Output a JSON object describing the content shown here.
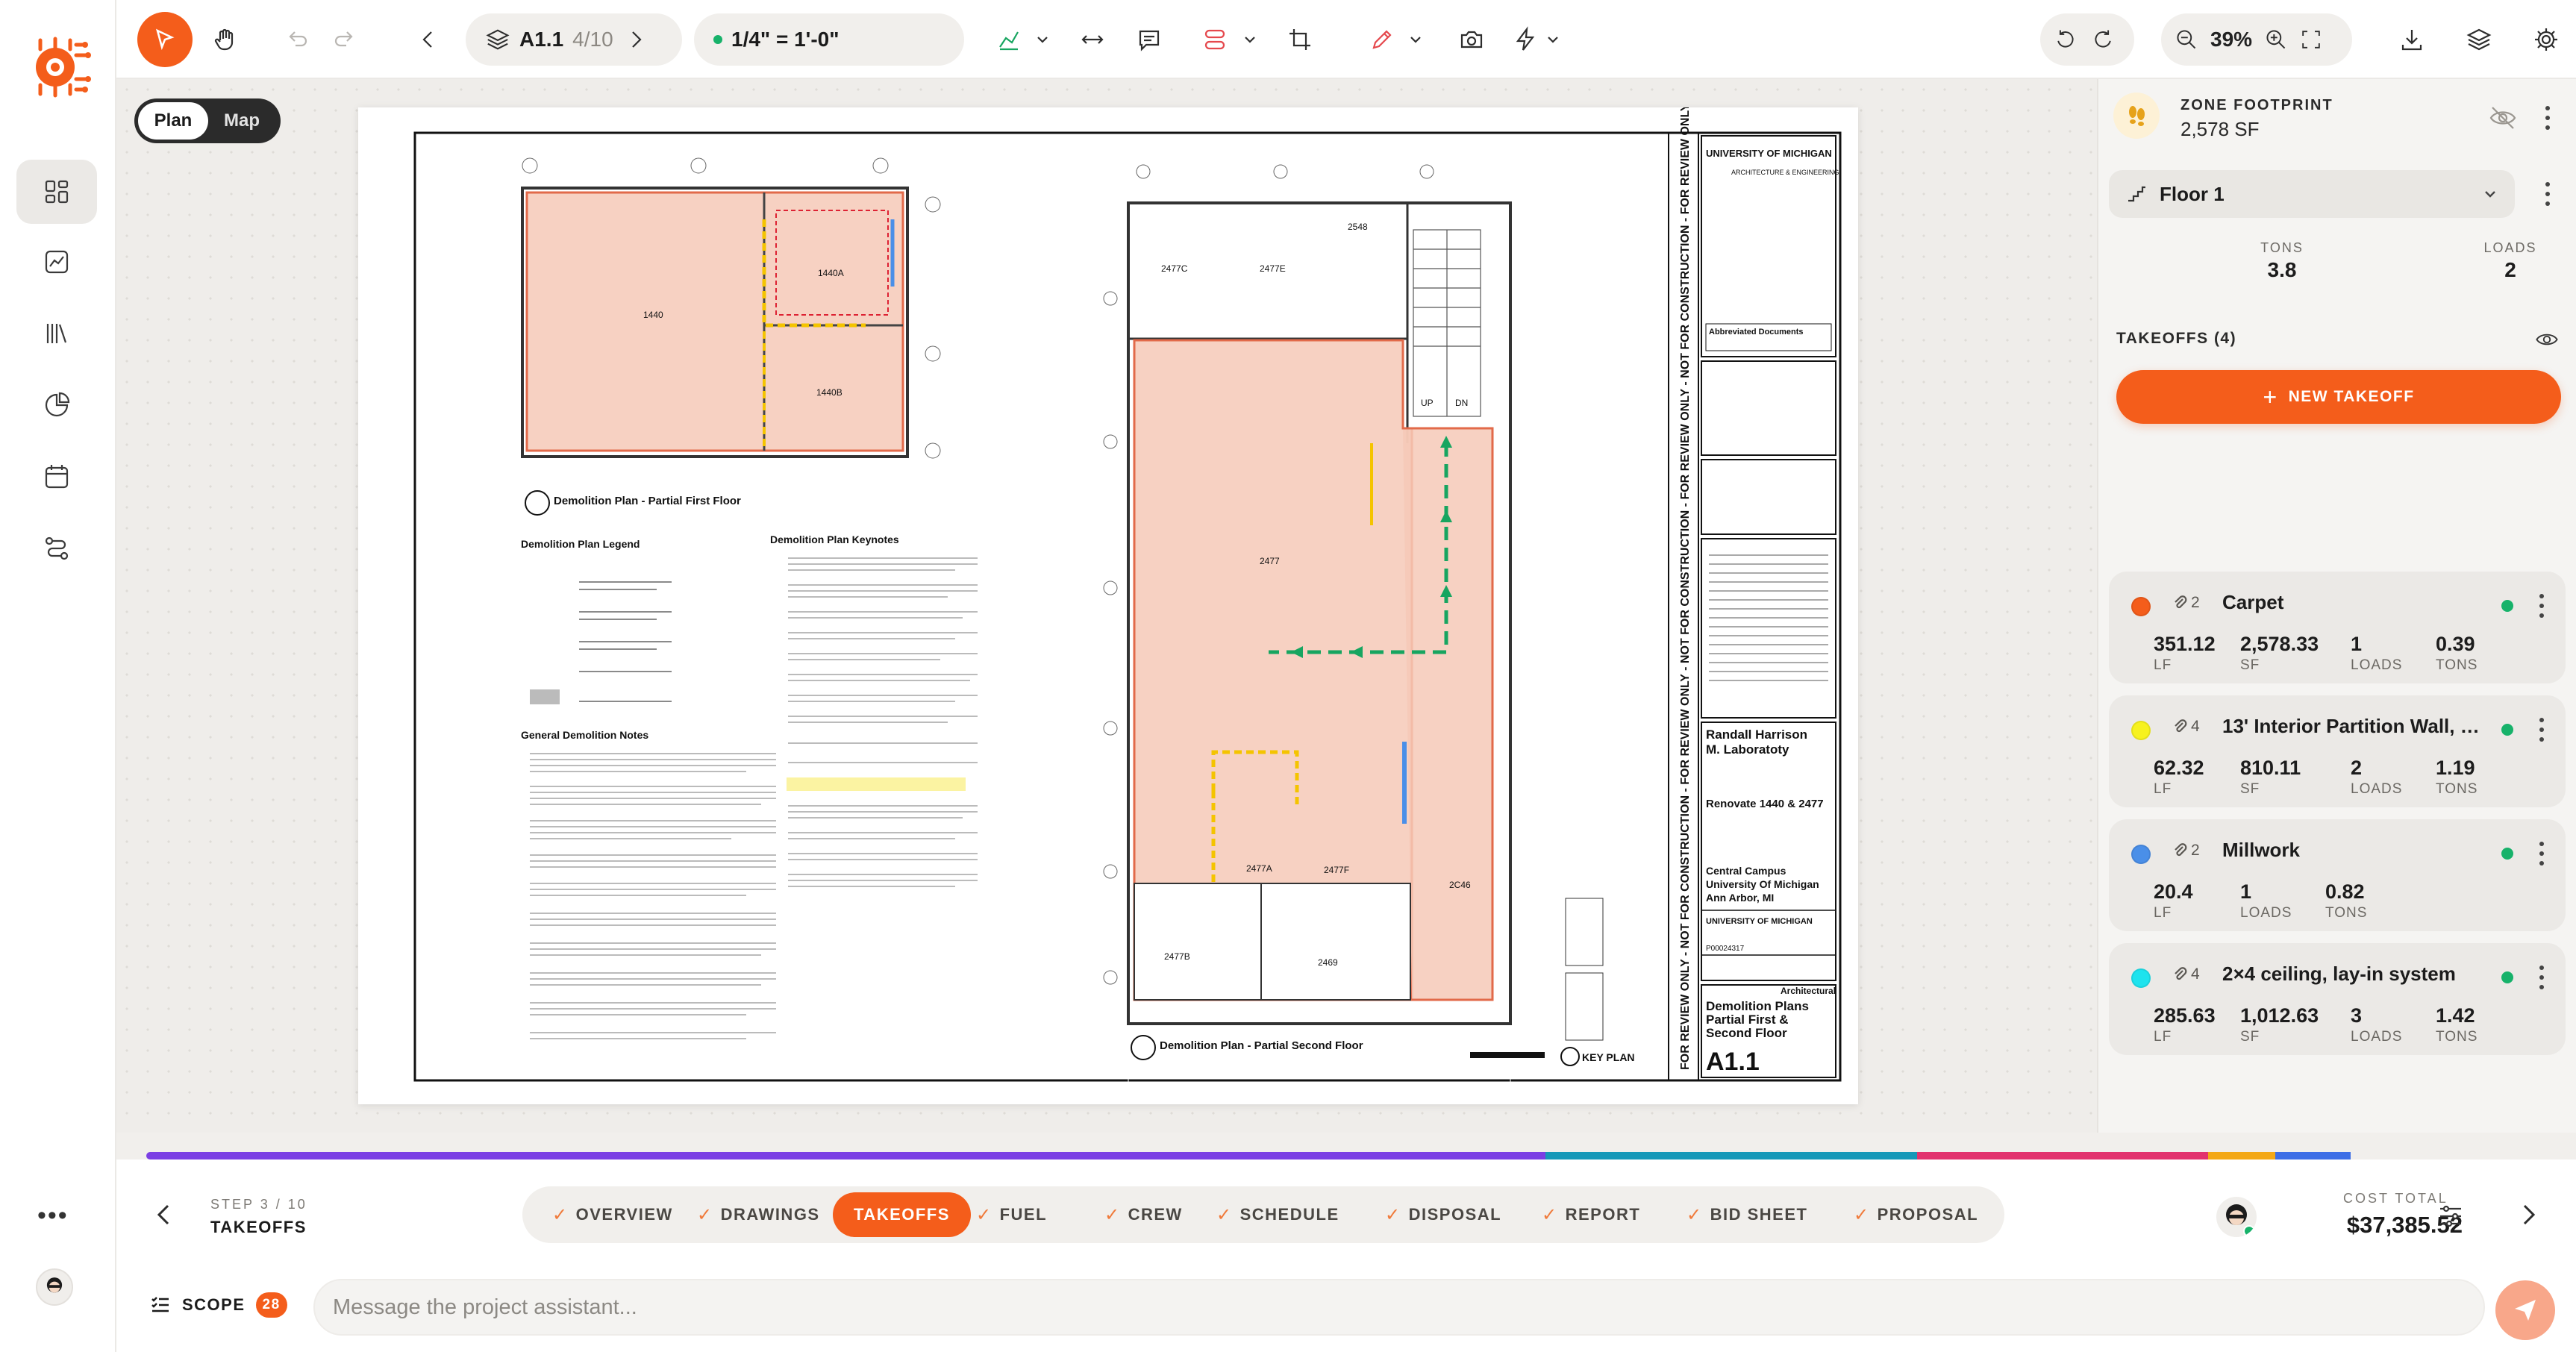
{
  "toolbar": {
    "sheet_code": "A1.1",
    "sheet_position": "4/10",
    "scale": "1/4\" = 1'-0\"",
    "zoom": "39%"
  },
  "view_toggle": {
    "plan": "Plan",
    "map": "Map"
  },
  "sheet": {
    "plan_first_title": "Demolition Plan - Partial First Floor",
    "plan_second_title": "Demolition Plan - Partial  Second Floor",
    "legend_title": "Demolition Plan Legend",
    "keynotes_title": "Demolition Plan Keynotes",
    "general_notes_title": "General Demolition Notes",
    "key_plan": "KEY PLAN",
    "vertical_banner": "FOR REVIEW ONLY - NOT FOR CONSTRUCTION - FOR REVIEW ONLY - NOT FOR CONSTRUCTION - FOR REVIEW ONLY - NOT FOR CONSTRUCTION - FOR REVIEW ONLY - NOT FOR CONSTRUCTION",
    "university": "UNIVERSITY OF MICHIGAN",
    "dept": "ARCHITECTURE & ENGINEERING",
    "abbrev": "Abbreviated Documents",
    "project_name_1": "Randall Harrison",
    "project_name_2": "M. Laboratoty",
    "renovate": "Renovate 1440 & 2477",
    "campus_1": "Central Campus",
    "campus_2": "University Of Michigan",
    "campus_3": "Ann Arbor, MI",
    "discipline": "Architectural",
    "sheet_title_1": "Demolition Plans",
    "sheet_title_2": "Partial First &",
    "sheet_title_3": "Second Floor",
    "sheet_number": "A1.1",
    "project_no": "P00024317",
    "room_1440": "1440",
    "room_1440a": "1440A",
    "room_1440b": "1440B",
    "room_2477": "2477",
    "room_2477c": "2477C",
    "room_2477a": "2477A",
    "room_2477b": "2477B",
    "room_2477f": "2477F",
    "room_2477e": "2477E",
    "room_2548": "2548",
    "room_2469": "2469",
    "room_2c46": "2C46",
    "up": "UP",
    "dn": "DN"
  },
  "panel": {
    "zone_label": "ZONE FOOTPRINT",
    "zone_area": "2,578 SF",
    "floor": "Floor 1",
    "tons_label": "TONS",
    "tons_value": "3.8",
    "loads_label": "LOADS",
    "loads_value": "2",
    "takeoffs_header": "TAKEOFFS (4)",
    "new_takeoff": "NEW TAKEOFF",
    "takeoffs": [
      {
        "name": "Carpet",
        "color": "#f45d1b",
        "count": "2",
        "metrics": [
          {
            "v": "351.12",
            "u": "LF"
          },
          {
            "v": "2,578.33",
            "u": "SF"
          },
          {
            "v": "1",
            "u": "LOADS"
          },
          {
            "v": "0.39",
            "u": "TONS"
          }
        ]
      },
      {
        "name": "13' Interior Partition Wall, M...",
        "color": "#f7f21e",
        "count": "4",
        "metrics": [
          {
            "v": "62.32",
            "u": "LF"
          },
          {
            "v": "810.11",
            "u": "SF"
          },
          {
            "v": "2",
            "u": "LOADS"
          },
          {
            "v": "1.19",
            "u": "TONS"
          }
        ]
      },
      {
        "name": "Millwork",
        "color": "#4a8fe8",
        "count": "2",
        "metrics": [
          {
            "v": "20.4",
            "u": "LF"
          },
          {
            "v": "1",
            "u": "LOADS"
          },
          {
            "v": "0.82",
            "u": "TONS"
          }
        ]
      },
      {
        "name": "2×4 ceiling, lay-in system",
        "color": "#1ee3ee",
        "count": "4",
        "metrics": [
          {
            "v": "285.63",
            "u": "LF"
          },
          {
            "v": "1,012.63",
            "u": "SF"
          },
          {
            "v": "3",
            "u": "LOADS"
          },
          {
            "v": "1.42",
            "u": "TONS"
          }
        ]
      }
    ]
  },
  "progress_segments": [
    {
      "color": "#7b3fe4",
      "fraction": 0.5827
    },
    {
      "color": "#1698b8",
      "fraction": 0.1546
    },
    {
      "color": "#e2336e",
      "fraction": 0.1214
    },
    {
      "color": "#f3a816",
      "fraction": 0.0279
    },
    {
      "color": "#3d6ee6",
      "fraction": 0.0314
    }
  ],
  "stepper": {
    "step_label": "STEP 3 / 10",
    "step_name": "TAKEOFFS",
    "steps": [
      "OVERVIEW",
      "DRAWINGS",
      "TAKEOFFS",
      "FUEL",
      "CREW",
      "SCHEDULE",
      "DISPOSAL",
      "REPORT",
      "BID SHEET",
      "PROPOSAL"
    ]
  },
  "cost": {
    "label": "COST TOTAL",
    "value": "$37,385.52"
  },
  "scope": {
    "label": "SCOPE",
    "count": "28"
  },
  "assistant": {
    "placeholder": "Message the project assistant..."
  },
  "rail": {
    "more": "•••"
  }
}
